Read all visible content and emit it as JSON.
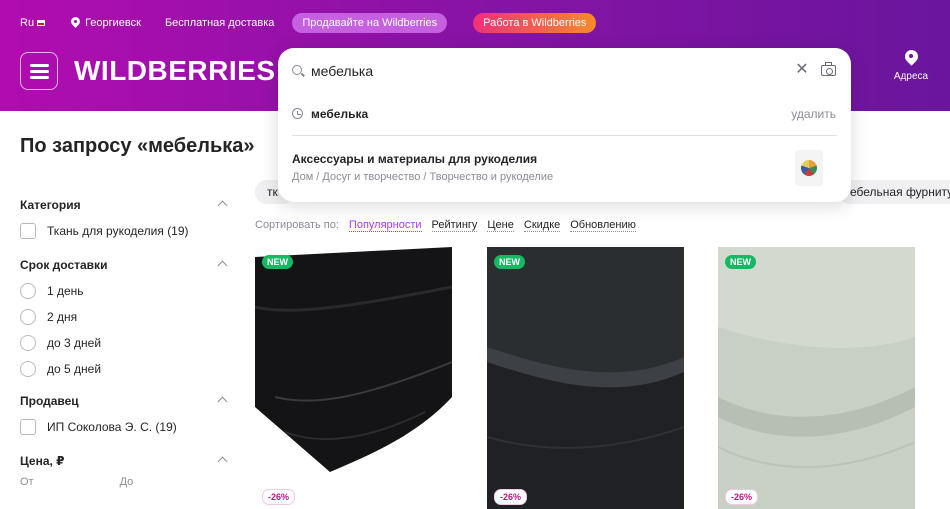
{
  "topbar": {
    "lang": "Ru",
    "city": "Георгиевск",
    "free_delivery": "Бесплатная доставка",
    "sell": "Продавайте на Wildberries",
    "work": "Работа в Wildberries"
  },
  "header": {
    "logo": "WILDBERRIES",
    "address_label": "Адреса"
  },
  "search": {
    "value": "мебелька",
    "history": [
      {
        "text": "мебелька",
        "delete_label": "удалить"
      }
    ],
    "suggestion": {
      "title": "Аксессуары и материалы для рукоделия",
      "path": "Дом / Досуг и творчество / Творчество и рукоделие"
    }
  },
  "page": {
    "title": "По запросу «мебелька»"
  },
  "filters": {
    "category": {
      "title": "Категория",
      "options": [
        "Ткань для рукоделия (19)"
      ]
    },
    "delivery": {
      "title": "Срок доставки",
      "options": [
        "1 день",
        "2 дня",
        "до 3 дней",
        "до 5 дней"
      ]
    },
    "seller": {
      "title": "Продавец",
      "options": [
        "ИП Соколова Э. С. (19)"
      ]
    },
    "price": {
      "title": "Цена, ₽",
      "from": "От",
      "to": "До"
    }
  },
  "chips": [
    "тк",
    "ебельная фурниту"
  ],
  "sort": {
    "label": "Сортировать по:",
    "options": [
      "Популярности",
      "Рейтингу",
      "Цене",
      "Скидке",
      "Обновлению"
    ],
    "active": "Популярности"
  },
  "products": [
    {
      "badge": "NEW",
      "discount": "-26%",
      "color": "#1b1b1d"
    },
    {
      "badge": "NEW",
      "discount": "-26%",
      "color": "#25272a"
    },
    {
      "badge": "NEW",
      "discount": "-26%",
      "color": "#c9d0c4"
    }
  ],
  "colors": {
    "accent": "#a73afd",
    "header_start": "#b10cb0",
    "header_end": "#6a159d",
    "new_badge": "#17b864",
    "discount": "#b4197f"
  }
}
